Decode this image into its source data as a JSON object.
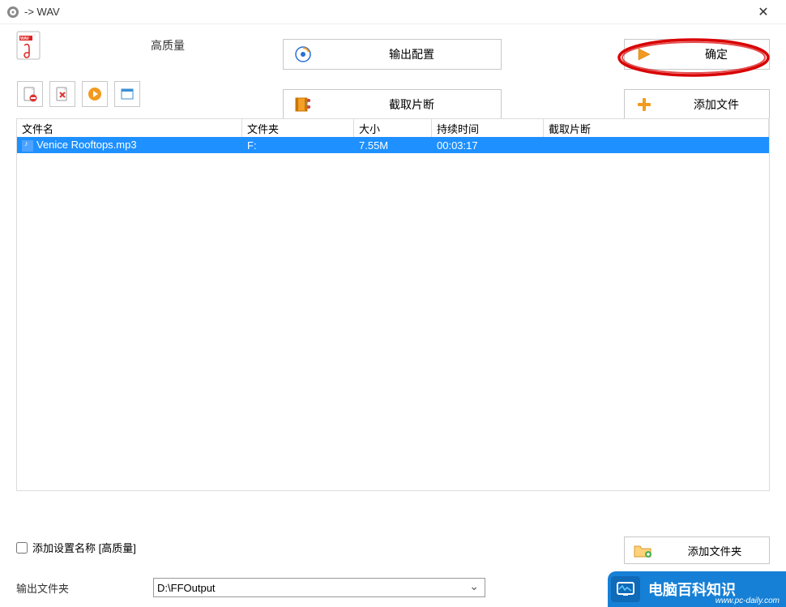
{
  "window": {
    "title": "-> WAV"
  },
  "top": {
    "quality_label": "高质量",
    "output_config_label": "输出配置",
    "ok_label": "确定"
  },
  "second": {
    "clip_label": "截取片断",
    "add_file_label": "添加文件"
  },
  "table": {
    "headers": {
      "name": "文件名",
      "folder": "文件夹",
      "size": "大小",
      "duration": "持续时间",
      "clip": "截取片断"
    },
    "rows": [
      {
        "name": "Venice Rooftops.mp3",
        "folder": "F:",
        "size": "7.55M",
        "duration": "00:03:17",
        "clip": ""
      }
    ]
  },
  "bottom": {
    "add_setting_label": "添加设置名称  [高质量]",
    "add_folder_label": "添加文件夹",
    "output_folder_label": "输出文件夹",
    "output_folder_value": "D:\\FFOutput"
  },
  "watermark": {
    "title": "电脑百科知识",
    "url": "www.pc-daily.com"
  }
}
